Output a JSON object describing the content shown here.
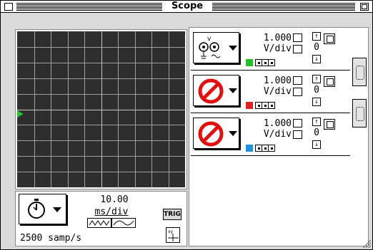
{
  "window": {
    "title": "Scope"
  },
  "timebase": {
    "value": "10.00",
    "units": "ms/div",
    "sample_rate": "2500 samp/s",
    "trig_label": "TRIG",
    "icon": "stopwatch-icon"
  },
  "channels": [
    {
      "scale": "1.000",
      "units": "V/div",
      "offset": "0",
      "color": "#22c022",
      "state": "active",
      "icon": "probe-icon"
    },
    {
      "scale": "1.000",
      "units": "V/div",
      "offset": "0",
      "color": "#e02020",
      "state": "off",
      "icon": "no-entry-icon"
    },
    {
      "scale": "1.000",
      "units": "V/div",
      "offset": "0",
      "color": "#2090e0",
      "state": "off",
      "icon": "no-entry-icon"
    }
  ],
  "colors": {
    "screen": "#2e2e2e",
    "grid": "#a0a0a0",
    "trigger_marker": "#2bbd2b"
  }
}
